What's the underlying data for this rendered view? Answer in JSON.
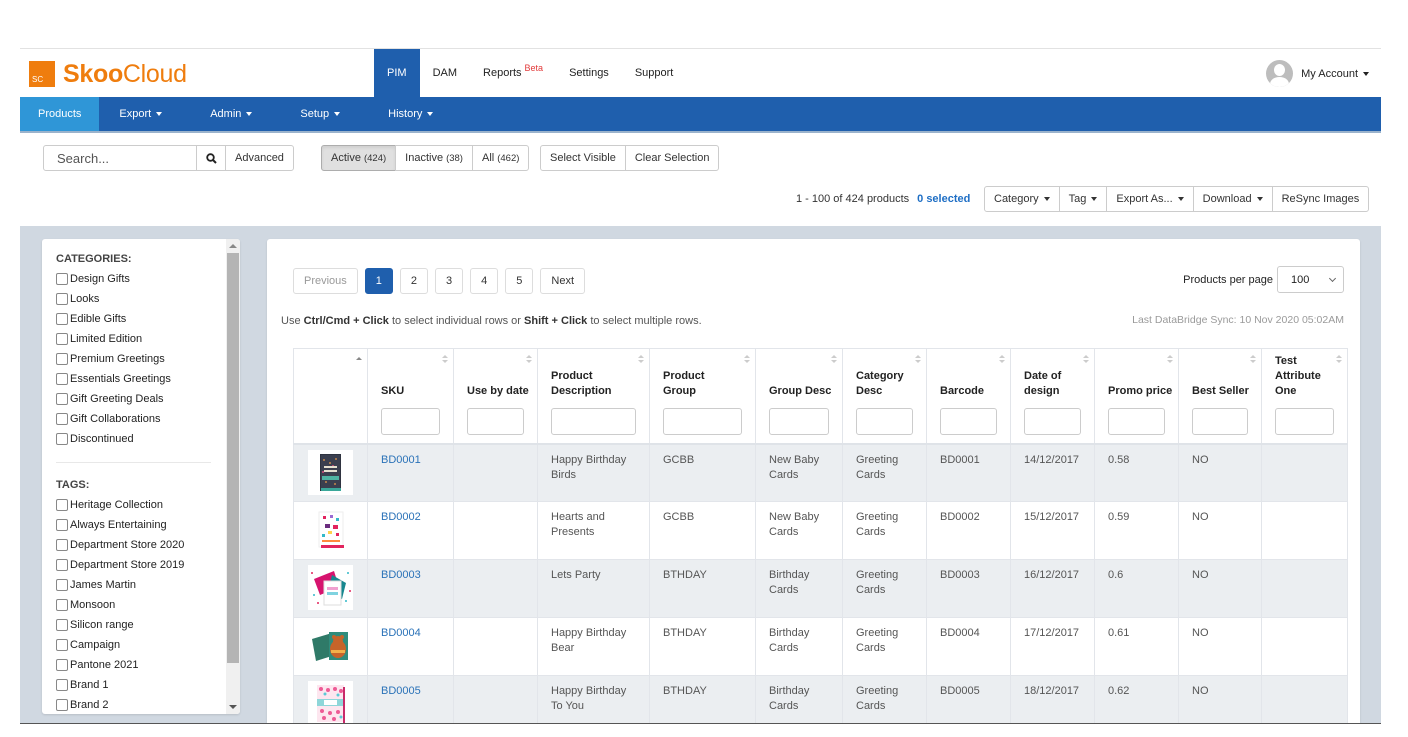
{
  "brand": {
    "mark": "SC",
    "name_bold": "Skoo",
    "name_rest": "Cloud",
    "color": "#ef7d0e"
  },
  "topnav": {
    "items": [
      {
        "label": "PIM",
        "active": true
      },
      {
        "label": "DAM"
      },
      {
        "label": "Reports",
        "badge": "Beta"
      },
      {
        "label": "Settings"
      },
      {
        "label": "Support"
      }
    ],
    "account_label": "My Account"
  },
  "subnav": {
    "items": [
      {
        "label": "Products",
        "active": true
      },
      {
        "label": "Export"
      },
      {
        "label": "Admin"
      },
      {
        "label": "Setup"
      },
      {
        "label": "History"
      }
    ]
  },
  "toolbar": {
    "search_placeholder": "Search...",
    "advanced_label": "Advanced",
    "filters": {
      "active_label": "Active",
      "active_count": "(424)",
      "inactive_label": "Inactive",
      "inactive_count": "(38)",
      "all_label": "All",
      "all_count": "(462)"
    },
    "select_visible_label": "Select Visible",
    "clear_selection_label": "Clear Selection",
    "product_range": "1 - 100 of 424 products",
    "selected_count": "0 selected",
    "actions": {
      "category": "Category",
      "tag": "Tag",
      "export_as": "Export As...",
      "download": "Download",
      "resync": "ReSync Images"
    }
  },
  "sidebar": {
    "categories_heading": "CATEGORIES:",
    "categories": [
      "Design Gifts",
      "Looks",
      "Edible Gifts",
      "Limited Edition",
      "Premium Greetings",
      "Essentials Greetings",
      "Gift Greeting Deals",
      "Gift Collaborations",
      "Discontinued"
    ],
    "tags_heading": "TAGS:",
    "tags": [
      "Heritage Collection",
      "Always Entertaining",
      "Department Store 2020",
      "Department Store 2019",
      "James Martin",
      "Monsoon",
      "Silicon range",
      "Campaign",
      "Pantone 2021",
      "Brand 1",
      "Brand 2"
    ]
  },
  "pagination": {
    "previous": "Previous",
    "pages": [
      "1",
      "2",
      "3",
      "4",
      "5"
    ],
    "current_page": "1",
    "next": "Next"
  },
  "hint": {
    "prefix": "Use ",
    "key1": "Ctrl/Cmd + Click",
    "middle": " to select individual rows or ",
    "key2": "Shift + Click",
    "suffix": " to select multiple rows."
  },
  "per_page": {
    "label": "Products per page",
    "value": "100"
  },
  "sync": "Last DataBridge Sync: 10 Nov 2020 05:02AM",
  "table": {
    "columns": [
      {
        "label": ""
      },
      {
        "label": "SKU"
      },
      {
        "label": "Use by date"
      },
      {
        "label": "Product Description"
      },
      {
        "label": "Product Group"
      },
      {
        "label": "Group Desc"
      },
      {
        "label": "Category Desc"
      },
      {
        "label": "Barcode"
      },
      {
        "label": "Date of design"
      },
      {
        "label": "Promo price"
      },
      {
        "label": "Best Seller"
      },
      {
        "label": "Test Attribute One"
      }
    ],
    "rows": [
      {
        "thumb": "card-dark-floral",
        "sku": "BD0001",
        "use_by": "",
        "desc": "Happy Birthday Birds",
        "group": "GCBB",
        "group_desc": "New Baby Cards",
        "category_desc": "Greeting Cards",
        "barcode": "BD0001",
        "date": "14/12/2017",
        "promo": "0.58",
        "best": "NO",
        "test": ""
      },
      {
        "thumb": "card-hearts-presents",
        "sku": "BD0002",
        "use_by": "",
        "desc": "Hearts and Presents",
        "group": "GCBB",
        "group_desc": "New Baby Cards",
        "category_desc": "Greeting Cards",
        "barcode": "BD0002",
        "date": "15/12/2017",
        "promo": "0.59",
        "best": "NO",
        "test": ""
      },
      {
        "thumb": "card-lets-party",
        "sku": "BD0003",
        "use_by": "",
        "desc": "Lets Party",
        "group": "BTHDAY",
        "group_desc": "Birthday Cards",
        "category_desc": "Greeting Cards",
        "barcode": "BD0003",
        "date": "16/12/2017",
        "promo": "0.6",
        "best": "NO",
        "test": ""
      },
      {
        "thumb": "card-bear",
        "sku": "BD0004",
        "use_by": "",
        "desc": "Happy Birthday Bear",
        "group": "BTHDAY",
        "group_desc": "Birthday Cards",
        "category_desc": "Greeting Cards",
        "barcode": "BD0004",
        "date": "17/12/2017",
        "promo": "0.61",
        "best": "NO",
        "test": ""
      },
      {
        "thumb": "card-pink-pattern",
        "sku": "BD0005",
        "use_by": "",
        "desc": "Happy Birthday To You",
        "group": "BTHDAY",
        "group_desc": "Birthday Cards",
        "category_desc": "Greeting Cards",
        "barcode": "BD0005",
        "date": "18/12/2017",
        "promo": "0.62",
        "best": "NO",
        "test": ""
      }
    ]
  }
}
